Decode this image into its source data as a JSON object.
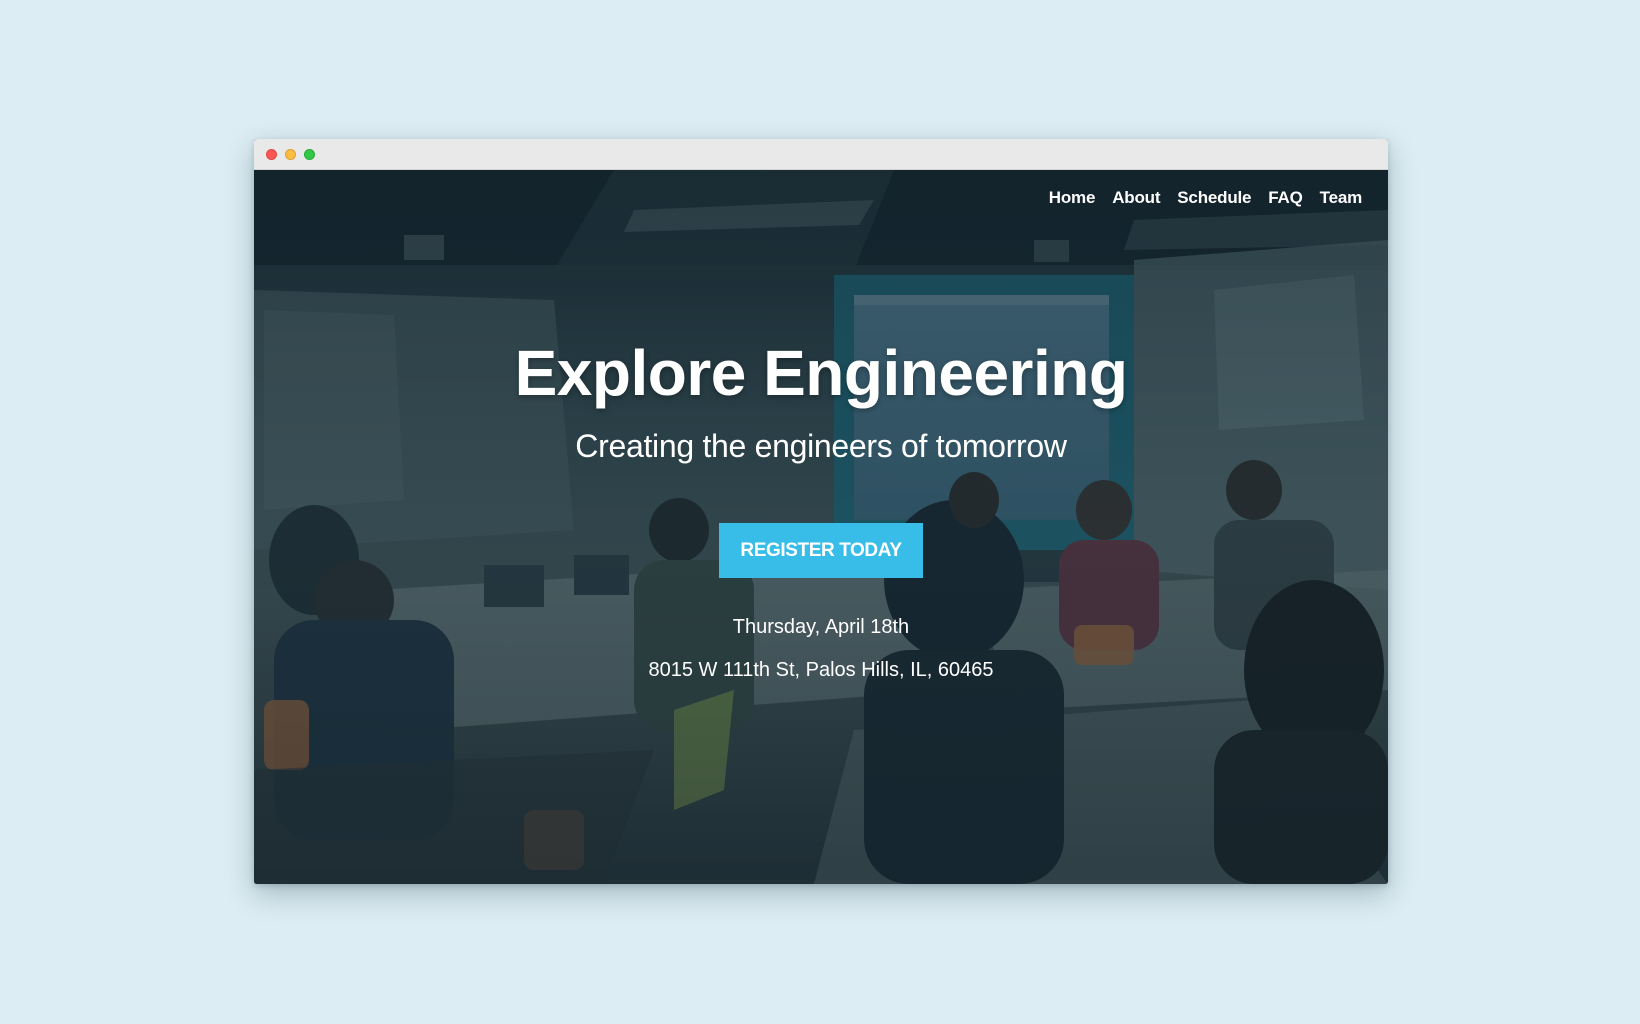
{
  "colors": {
    "page_background": "#dcedf3",
    "accent": "#38bde9",
    "text": "#ffffff"
  },
  "window": {
    "controls": [
      "close",
      "minimize",
      "maximize"
    ]
  },
  "nav": {
    "items": [
      {
        "label": "Home"
      },
      {
        "label": "About"
      },
      {
        "label": "Schedule"
      },
      {
        "label": "FAQ"
      },
      {
        "label": "Team"
      }
    ]
  },
  "hero": {
    "title": "Explore Engineering",
    "subtitle": "Creating the engineers of tomorrow",
    "cta_label": "REGISTER TODAY",
    "date": "Thursday, April 18th",
    "address": "8015 W 111th St, Palos Hills, IL, 60465"
  }
}
